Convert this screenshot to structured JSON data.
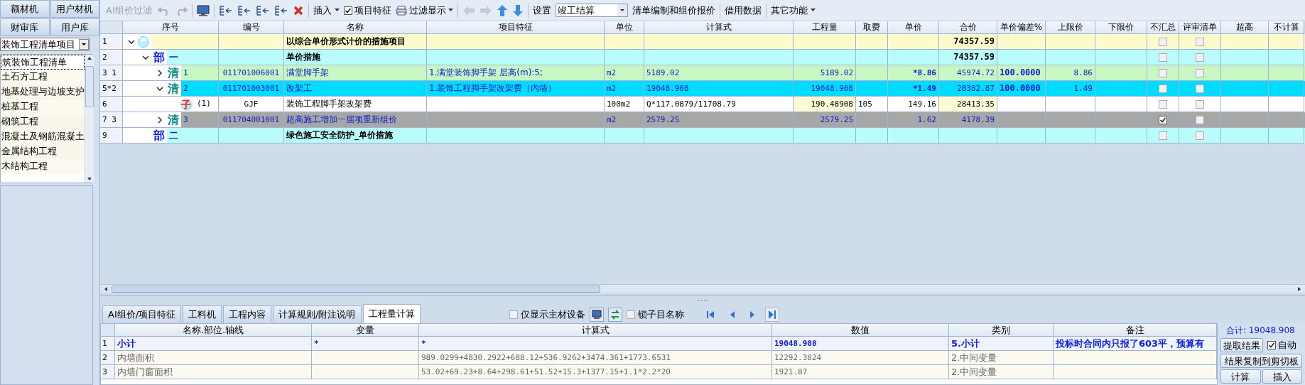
{
  "library_tabs": [
    {
      "label": "额材机",
      "selected": false
    },
    {
      "label": "用户材机",
      "selected": false
    },
    {
      "label": "财审库",
      "selected": false
    },
    {
      "label": "用户库",
      "selected": false
    }
  ],
  "library_select": {
    "value": "装饰工程清单项目"
  },
  "library_items": [
    {
      "label": "筑装饰工程清单",
      "selected": true
    },
    {
      "label": "土石方工程",
      "selected": false
    },
    {
      "label": "地基处理与边坡支护",
      "selected": false
    },
    {
      "label": "桩基工程",
      "selected": false
    },
    {
      "label": "砌筑工程",
      "selected": false
    },
    {
      "label": "混凝土及钢筋混凝土",
      "selected": false
    },
    {
      "label": "金属结构工程",
      "selected": false
    },
    {
      "label": "木结构工程",
      "selected": false
    }
  ],
  "toolbar": {
    "ai_filter": {
      "label": "AI组价过滤",
      "disabled": true
    },
    "history": {
      "disabled": true
    },
    "insert": "插入",
    "feature": {
      "label": "项目特征",
      "checked": true
    },
    "filter_display": "过滤显示",
    "nav_back": {
      "disabled": true
    },
    "settings": "设置",
    "mode": {
      "value": "竣工结算"
    },
    "billing": "清单编制和组价报价",
    "borrow": "借用数据",
    "other": "其它功能"
  },
  "table": {
    "columns": [
      "序号",
      "编号",
      "名称",
      "项目特征",
      "单位",
      "计算式",
      "工程量",
      "取费",
      "单价",
      "合价",
      "单价偏差%",
      "上限价",
      "下限价",
      "不汇总",
      "评审清单",
      "超高",
      "不计算"
    ],
    "rows": [
      {
        "row": "1",
        "kind": "root",
        "expanded": true,
        "selected": false,
        "name": "以综合单价形式计价的措施项目",
        "total": "74357.59",
        "no_sum": false,
        "review": false,
        "children": [
          {
            "row": "2",
            "kind": "section",
            "badge": "部",
            "seq": "一",
            "expanded": true,
            "selected": false,
            "name": "单价措施",
            "total": "74357.59",
            "no_sum": false,
            "review": false,
            "children": [
              {
                "row": "3 1",
                "kind": "item",
                "badge": "清",
                "seq": "1",
                "expanded": false,
                "selected": false,
                "code": "011701006001",
                "name": "满堂脚手架",
                "feature": "1.满堂装饰脚手架 层高(m):5;",
                "unit": "m2",
                "formula": "5189.02",
                "qty": "5189.02",
                "price": "*8.86",
                "total": "45974.72",
                "deviation": "100.0000",
                "upper": "8.86",
                "no_sum": false,
                "review": false
              },
              {
                "row": "5*2",
                "kind": "item",
                "badge": "清",
                "seq": "2",
                "expanded": true,
                "selected": true,
                "code": "011701003001",
                "name": "改架工",
                "feature": "1.装饰工程脚手架改架费（内墙）",
                "unit": "m2",
                "formula": "19048.908",
                "qty": "19048.908",
                "price": "*1.49",
                "total": "28382.87",
                "deviation": "100.0000",
                "upper": "1.49",
                "no_sum": false,
                "review": false,
                "children": [
                  {
                    "row": "6",
                    "kind": "sub",
                    "badge": "子",
                    "seq": "(1)",
                    "selected": false,
                    "code": "GJF",
                    "name": "装饰工程脚手架改架费",
                    "unit": "100m2",
                    "formula": "Q*117.0879/11708.79",
                    "qty": "190.48908",
                    "fee": "105",
                    "price": "149.16",
                    "total": "28413.35",
                    "no_sum": false,
                    "review": false
                  }
                ]
              },
              {
                "row": "7 3",
                "kind": "item",
                "badge": "清",
                "seq": "3",
                "expanded": false,
                "selected": false,
                "code": "011704001001",
                "name": "超高施工增加一届项重新组价",
                "unit": "m2",
                "formula": "2579.25",
                "qty": "2579.25",
                "price": "1.62",
                "total": "4178.39",
                "no_sum": true,
                "review": false
              }
            ]
          },
          {
            "row": "9",
            "kind": "section",
            "badge": "部",
            "seq": "二",
            "selected": false,
            "name": "绿色施工安全防护_单价措施",
            "no_sum": false,
            "review": false
          }
        ]
      }
    ]
  },
  "detail_tabs": [
    {
      "label": "AI组价/项目特征",
      "selected": false
    },
    {
      "label": "工料机",
      "selected": false
    },
    {
      "label": "工程内容",
      "selected": false
    },
    {
      "label": "计算规则/附注说明",
      "selected": false
    },
    {
      "label": "工程量计算",
      "selected": true
    }
  ],
  "detail_options": [
    {
      "label": "仅显示主材设备",
      "checked": false
    },
    {
      "label": "锁子目名称",
      "checked": false
    }
  ],
  "calc_table": {
    "columns": [
      "名称.部位.轴线",
      "变量",
      "计算式",
      "数值",
      "类别",
      "备注"
    ],
    "rows": [
      {
        "row": "1",
        "kind": "subtotal",
        "name": "小计",
        "variable": "*",
        "formula": "*",
        "value": "19048.908",
        "category": "5.小计",
        "note": "投标时合同内只报了603平，预算有"
      },
      {
        "row": "2",
        "kind": "variable",
        "name": "内墙面积",
        "formula": "989.0299+4830.2922+688.12+536.9262+3474.361+1773.6531",
        "value": "12292.3824",
        "category": "2.中间变量"
      },
      {
        "row": "3",
        "kind": "variable",
        "name": "内墙门窗面积",
        "formula": "53.02+69.23+8.64+298.61+51.52+15.3+1377.15+1.1*2.2*20",
        "value": "1921.87",
        "category": "2.中间变量"
      }
    ]
  },
  "calc_panel": {
    "total": "合计: 19048.908",
    "extract": "提取结果",
    "auto": {
      "label": "自动",
      "checked": true
    },
    "copy": "结果复制到剪切板",
    "calculate": "计算",
    "insert": "插入"
  }
}
